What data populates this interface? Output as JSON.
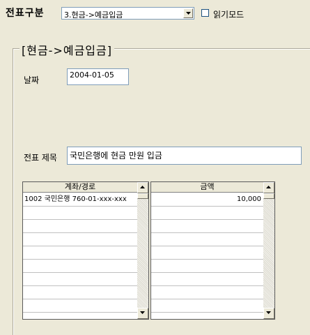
{
  "header": {
    "voucher_type_label": "전표구분",
    "voucher_type_value": "3.현금->예금입금",
    "read_mode_label": "읽기모드",
    "read_mode_checked": false
  },
  "group": {
    "title": "[현금->예금입금]",
    "date_label": "날짜",
    "date_value": "2004-01-05",
    "subject_label": "전표 제목",
    "subject_value": "국민은행에 현금 만원 입금"
  },
  "account_grid": {
    "header": "계좌/경로",
    "rows": [
      "1002 국민은행 760-01-xxx-xxx",
      "",
      "",
      "",
      "",
      "",
      "",
      "",
      ""
    ]
  },
  "amount_grid": {
    "header": "금액",
    "rows": [
      "10,000",
      "",
      "",
      "",
      "",
      "",
      "",
      "",
      ""
    ]
  },
  "icons": {
    "combo_arrow": "chevron-down-icon",
    "scroll_up": "arrow-up-icon",
    "scroll_down": "arrow-down-icon"
  }
}
